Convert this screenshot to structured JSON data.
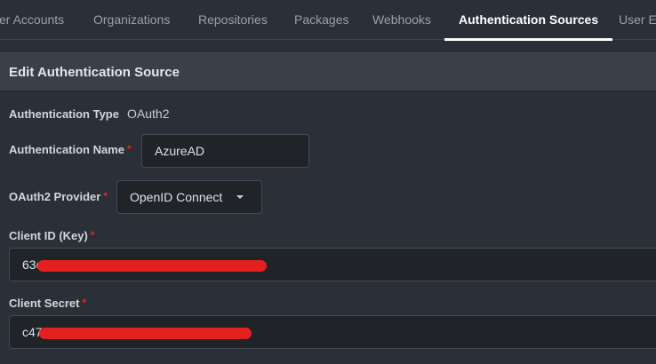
{
  "tabs": [
    {
      "label": "er Accounts",
      "active": false
    },
    {
      "label": "Organizations",
      "active": false
    },
    {
      "label": "Repositories",
      "active": false
    },
    {
      "label": "Packages",
      "active": false
    },
    {
      "label": "Webhooks",
      "active": false
    },
    {
      "label": "Authentication Sources",
      "active": true
    },
    {
      "label": "User Er",
      "active": false
    }
  ],
  "section": {
    "title": "Edit Authentication Source"
  },
  "form": {
    "auth_type": {
      "label": "Authentication Type",
      "value": "OAuth2"
    },
    "auth_name": {
      "label": "Authentication Name",
      "required_mark": "*",
      "value": "AzureAD"
    },
    "oauth2_provider": {
      "label": "OAuth2 Provider",
      "required_mark": "*",
      "selected": "OpenID Connect"
    },
    "client_id": {
      "label": "Client ID (Key)",
      "required_mark": "*",
      "visible_value": "63c",
      "redacted": true
    },
    "client_secret": {
      "label": "Client Secret",
      "required_mark": "*",
      "visible_value": "c47",
      "redacted": true
    }
  },
  "colors": {
    "required": "#db2828",
    "redaction": "#e3201e",
    "active_tab": "#ffffff"
  }
}
